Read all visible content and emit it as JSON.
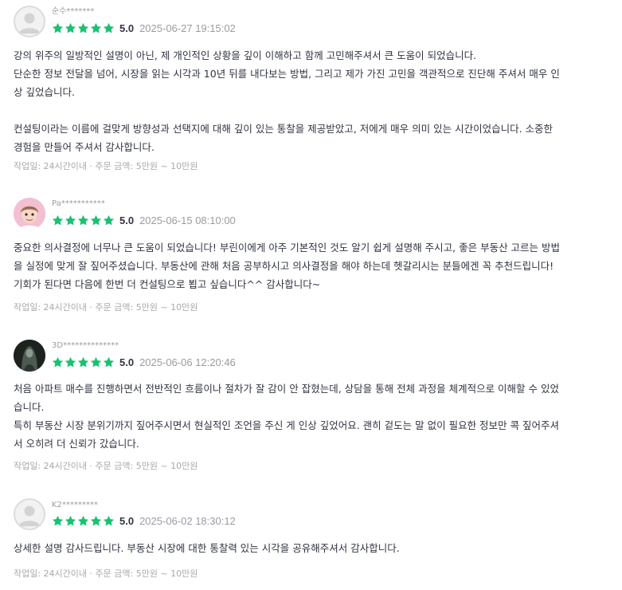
{
  "reviews": [
    {
      "nickname": "순수*******",
      "avatar": "default-avatar",
      "score": "5.0",
      "date": "2025-06-27 19:15:02",
      "lines": [
        "강의 위주의 일방적인 설명이 아닌, 제 개인적인 상황을 깊이 이해하고 함께 고민해주셔서 큰 도움이 되었습니다.",
        "단순한 정보 전달을 넘어, 시장을 읽는 시각과 10년 뒤를 내다보는 방법, 그리고 제가 가진 고민을 객관적으로 진단해 주셔서 매우 인",
        "상 깊었습니다.",
        "",
        "컨설팅이라는 이름에 걸맞게 방향성과 선택지에 대해 깊이 있는 통찰을 제공받았고, 저에게 매우 의미 있는 시간이었습니다. 소중한",
        "경험을 만들어 주셔서 감사합니다."
      ],
      "meta": "작업일: 24시간이내 · 주문 금액: 5만원 ~ 10만원"
    },
    {
      "nickname": "Pa***********",
      "avatar": "profile-photo-pink",
      "score": "5.0",
      "date": "2025-06-15 08:10:00",
      "lines": [
        "중요한 의사결정에 너무나 큰 도움이 되었습니다! 부린이에게 아주 기본적인 것도 알기 쉽게 설명해 주시고, 좋은 부동산 고르는 방법",
        "을 실정에 맞게 잘 짚어주셨습니다. 부동산에 관해 처음 공부하시고 의사결정을 해야 하는데 헷갈리시는 분들에겐 꼭 추천드립니다!",
        "기회가 된다면 다음에 한번 더 컨설팅으로 뵙고 싶습니다^^ 감사합니다~"
      ],
      "meta": "작업일: 24시간이내 · 주문 금액: 5만원 ~ 10만원"
    },
    {
      "nickname": "3D**************",
      "avatar": "profile-photo-dark",
      "score": "5.0",
      "date": "2025-06-06 12:20:46",
      "lines": [
        "처음 아파트 매수를 진행하면서 전반적인 흐름이나 절차가 잘 감이 안 잡혔는데, 상담을 통해 전체 과정을 체계적으로 이해할 수 있었",
        "습니다.",
        "특히 부동산 시장 분위기까지 짚어주시면서 현실적인 조언을 주신 게 인상 깊었어요. 괜히 겉도는 말 없이 필요한 정보만 콕 짚어주셔",
        "서 오히려 더 신뢰가 갔습니다."
      ],
      "meta": "작업일: 24시간이내 · 주문 금액: 5만원 ~ 10만원"
    },
    {
      "nickname": "K2*********",
      "avatar": "default-avatar",
      "score": "5.0",
      "date": "2025-06-02 18:30:12",
      "lines": [
        "상세한 설명 감사드립니다. 부동산 시장에 대한 통찰력 있는 시각을 공유해주셔서 감사합니다."
      ],
      "meta": "작업일: 24시간이내 · 주문 금액: 5만원 ~ 10만원"
    }
  ],
  "star_color": "#18c26f",
  "star_icon": "star-icon"
}
